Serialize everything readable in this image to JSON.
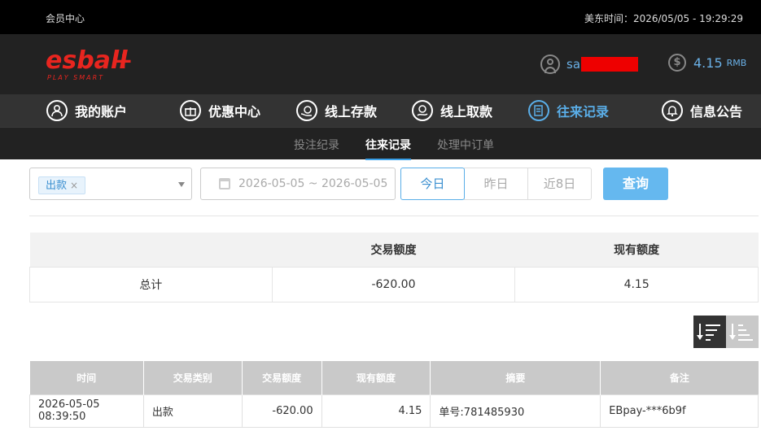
{
  "topbar": {
    "member_center": "会员中心",
    "time_label": "美东时间：",
    "time_value": "2026/05/05 - 19:29:29"
  },
  "header": {
    "logo_text": "esball+",
    "logo_tagline": "PLAY SMART",
    "username_visible": "sa",
    "balance": "4.15",
    "currency": "RMB"
  },
  "mainnav": [
    {
      "label": "我的账户",
      "icon": "user-icon"
    },
    {
      "label": "优惠中心",
      "icon": "gift-icon"
    },
    {
      "label": "线上存款",
      "icon": "deposit-icon"
    },
    {
      "label": "线上取款",
      "icon": "withdraw-icon"
    },
    {
      "label": "往来记录",
      "icon": "records-icon",
      "active": true
    },
    {
      "label": "信息公告",
      "icon": "bell-icon"
    }
  ],
  "subnav": [
    {
      "label": "投注纪录"
    },
    {
      "label": "往来记录",
      "active": true
    },
    {
      "label": "处理中订单"
    }
  ],
  "filter": {
    "type_tag": "出款",
    "date_range": "2026-05-05 ~ 2026-05-05",
    "quick": [
      "今日",
      "昨日",
      "近8日"
    ],
    "query_label": "查询"
  },
  "summary": {
    "headers": [
      "",
      "交易额度",
      "现有额度"
    ],
    "row": [
      "总计",
      "-620.00",
      "4.15"
    ]
  },
  "records": {
    "headers": [
      "时间",
      "交易类别",
      "交易额度",
      "现有额度",
      "摘要",
      "备注"
    ],
    "rows": [
      [
        "2026-05-05 08:39:50",
        "出款",
        "-620.00",
        "4.15",
        "单号:781485930",
        "EBpay-***6b9f"
      ]
    ]
  },
  "colors": {
    "accent": "#5aaee8",
    "query_button": "#65b8ef",
    "redaction": "#e00000"
  }
}
